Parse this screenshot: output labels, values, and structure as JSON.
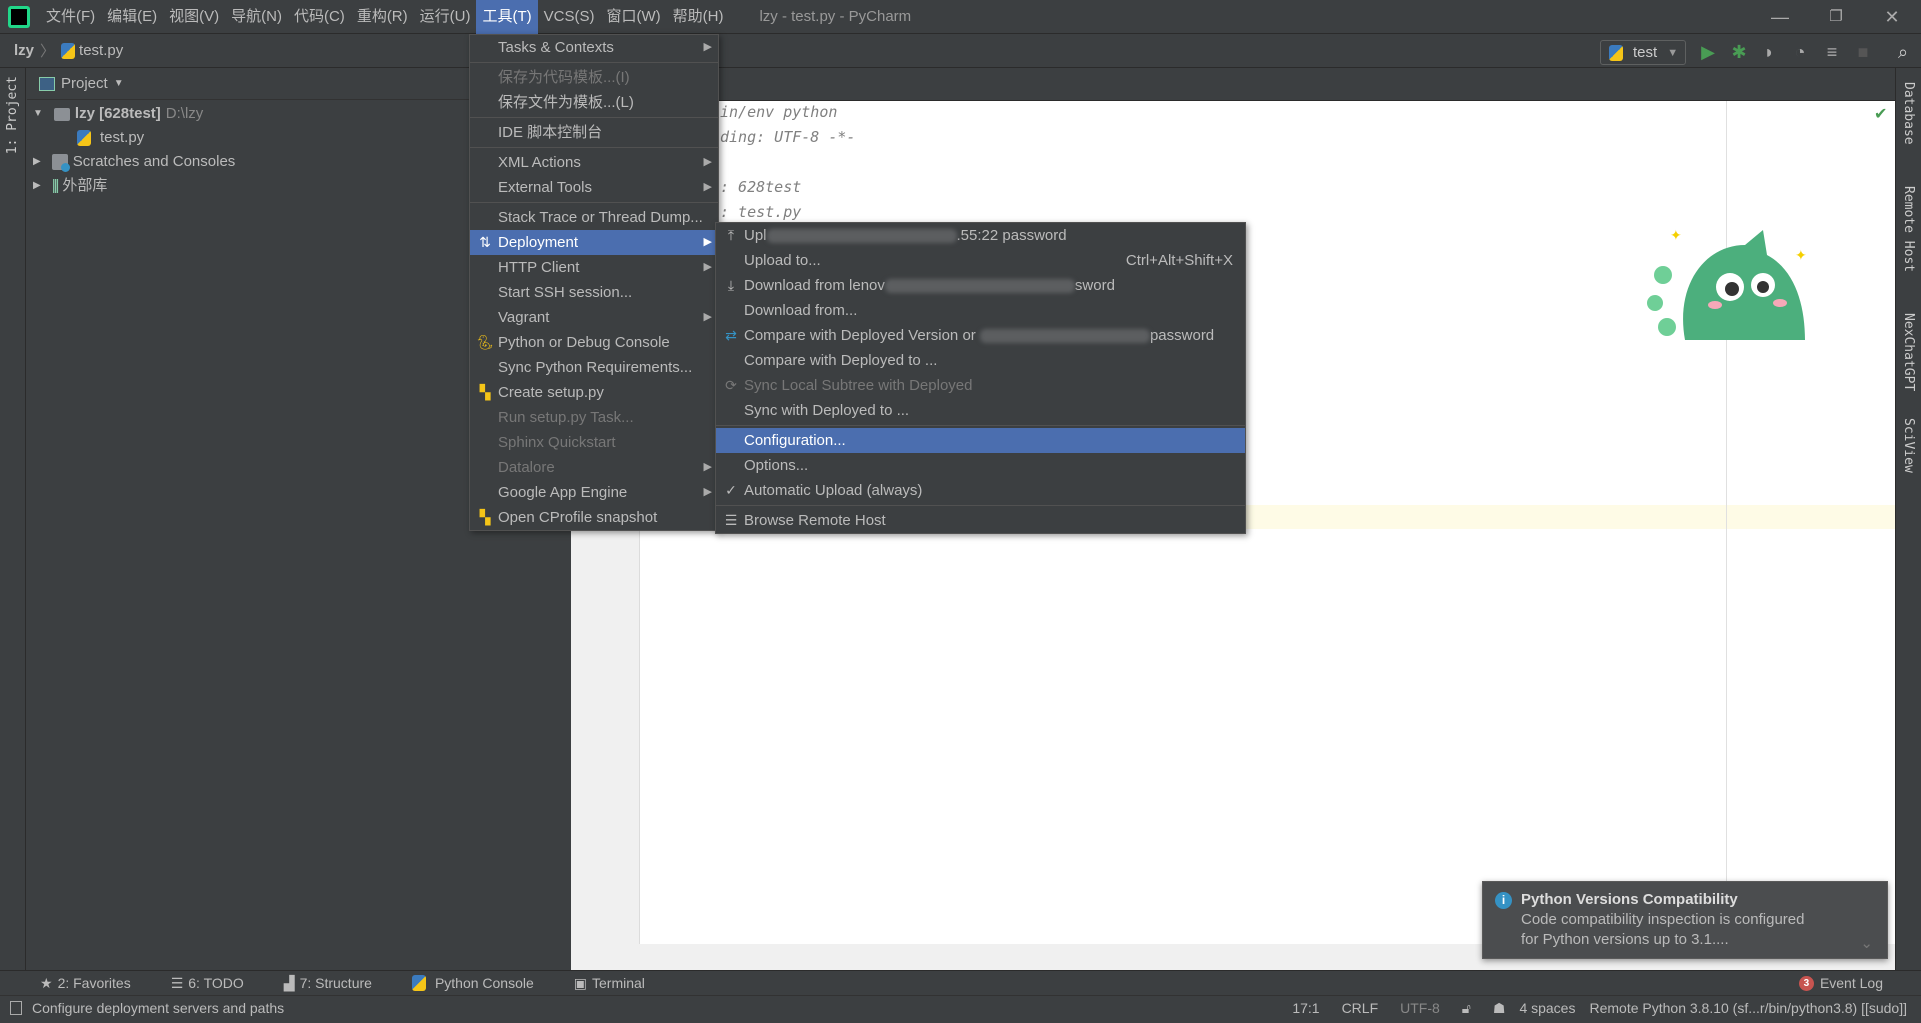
{
  "menubar": {
    "items": [
      "文件(F)",
      "编辑(E)",
      "视图(V)",
      "导航(N)",
      "代码(C)",
      "重构(R)",
      "运行(U)",
      "工具(T)",
      "VCS(S)",
      "窗口(W)",
      "帮助(H)"
    ],
    "active_index": 7,
    "title": "lzy - test.py - PyCharm"
  },
  "window_controls": {
    "minimize": "—",
    "restore": "❐",
    "close": "✕"
  },
  "breadcrumb": {
    "project": "lzy",
    "file": "test.py"
  },
  "run_config": {
    "name": "test"
  },
  "left_strip": {
    "project_tab": "1: Project"
  },
  "project_panel": {
    "header": "Project",
    "tree": [
      {
        "name": "lzy [628test]",
        "path": "D:\\lzy"
      },
      {
        "name": "test.py"
      },
      {
        "name": "Scratches and Consoles"
      },
      {
        "name": "外部库"
      }
    ]
  },
  "editor": {
    "lines": [
      "in/env python",
      "ding: UTF-8 -*-",
      "",
      ": 628test",
      ": test.py"
    ]
  },
  "right_strip": [
    "Database",
    "Remote Host",
    "NexChatGPT",
    "SciView"
  ],
  "tools_menu": {
    "items": [
      {
        "label": "Tasks & Contexts",
        "submenu": true
      },
      {
        "sep": true
      },
      {
        "label": "保存为代码模板...(I)",
        "disabled": true
      },
      {
        "label": "保存文件为模板...(L)"
      },
      {
        "sep": true
      },
      {
        "label": "IDE 脚本控制台"
      },
      {
        "sep": true
      },
      {
        "label": "XML Actions",
        "submenu": true
      },
      {
        "label": "External Tools",
        "submenu": true
      },
      {
        "sep": true
      },
      {
        "label": "Stack Trace or Thread Dump..."
      },
      {
        "label": "Deployment",
        "submenu": true,
        "selected": true,
        "icon": "deployment-icon"
      },
      {
        "label": "HTTP Client",
        "submenu": true
      },
      {
        "label": "Start SSH session..."
      },
      {
        "label": "Vagrant",
        "submenu": true
      },
      {
        "label": "Python or Debug Console",
        "icon": "python-console-icon"
      },
      {
        "label": "Sync Python Requirements..."
      },
      {
        "label": "Create setup.py",
        "icon": "python-file-icon"
      },
      {
        "label": "Run setup.py Task...",
        "disabled": true
      },
      {
        "label": "Sphinx Quickstart",
        "disabled": true
      },
      {
        "label": "Datalore",
        "submenu": true,
        "disabled": true
      },
      {
        "label": "Google App Engine",
        "submenu": true
      },
      {
        "label": "Open CProfile snapshot",
        "icon": "cprofile-icon"
      }
    ]
  },
  "deployment_menu": {
    "items": [
      {
        "prefix": "Upl",
        "suffix": ".55:22 password",
        "redacted": true,
        "icon": "upload-icon"
      },
      {
        "label": "Upload to...",
        "shortcut": "Ctrl+Alt+Shift+X"
      },
      {
        "prefix": "Download from lenov",
        "suffix": "sword",
        "redacted": true,
        "icon": "download-icon"
      },
      {
        "label": "Download from..."
      },
      {
        "prefix": "Compare with Deployed Version or ",
        "suffix": "password",
        "redacted": true,
        "icon": "compare-icon"
      },
      {
        "label": "Compare with Deployed to ..."
      },
      {
        "label": "Sync Local Subtree with Deployed",
        "disabled": true,
        "icon": "sync-icon"
      },
      {
        "label": "Sync with Deployed to ..."
      },
      {
        "sep": true
      },
      {
        "label": "Configuration...",
        "selected": true
      },
      {
        "label": "Options..."
      },
      {
        "label": "Automatic Upload (always)",
        "icon": "check-icon"
      },
      {
        "sep": true
      },
      {
        "label": "Browse Remote Host",
        "icon": "server-icon"
      }
    ]
  },
  "notification": {
    "title": "Python Versions Compatibility",
    "body_line1": "Code compatibility inspection is configured",
    "body_line2": "for Python versions up to 3.1...."
  },
  "bottom_tools": [
    "2: Favorites",
    "6: TODO",
    "7: Structure",
    "Python Console",
    "Terminal"
  ],
  "event_log": {
    "label": "Event Log",
    "count": "3"
  },
  "status": {
    "message": "Configure deployment servers and paths",
    "position": "17:1",
    "line_sep": "CRLF",
    "encoding": "UTF-8",
    "indent": "4 spaces",
    "interpreter": "Remote Python 3.8.10 (sf...r/bin/python3.8) [[sudo]]"
  },
  "colors": {
    "accent": "#4b6eaf",
    "run": "#499c54",
    "bg": "#3c3f41"
  }
}
